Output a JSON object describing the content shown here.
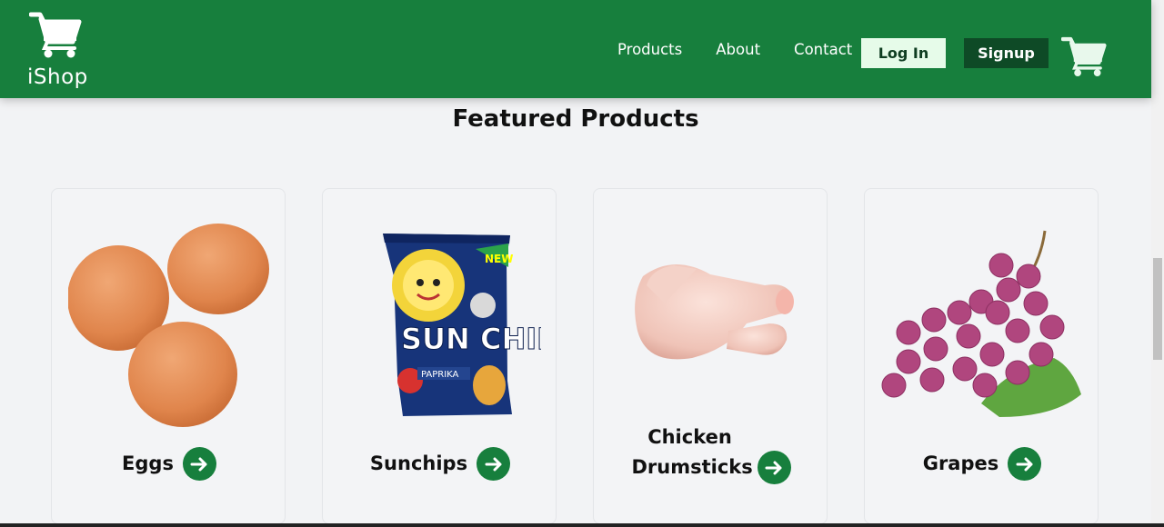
{
  "header": {
    "logo_text": "iShop",
    "nav": [
      "Products",
      "About",
      "Contact"
    ],
    "login_label": "Log In",
    "signup_label": "Signup",
    "brand_color": "#177f3d"
  },
  "main": {
    "title": "Featured Products",
    "products": [
      {
        "name": "Eggs"
      },
      {
        "name": "Sunchips"
      },
      {
        "name": "Chicken Drumsticks"
      },
      {
        "name": "Grapes"
      }
    ]
  },
  "icons": {
    "logo": "cart-icon",
    "cart": "cart-icon",
    "product_link": "arrow-right-icon"
  },
  "image_text": {
    "chips_brand": "SUN CHIPS",
    "chips_badge": "NEW",
    "chips_flavor": "PAPRIKA"
  }
}
